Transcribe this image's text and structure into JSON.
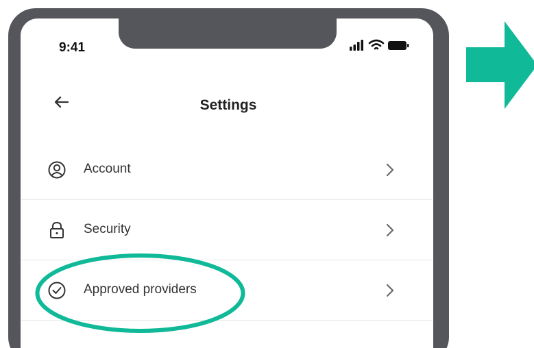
{
  "status_bar": {
    "time": "9:41",
    "signal_icon": "cellular-signal-icon",
    "wifi_icon": "wifi-icon",
    "battery_icon": "battery-icon"
  },
  "header": {
    "back_icon": "back-arrow-icon",
    "title": "Settings"
  },
  "settings": {
    "items": [
      {
        "label": "Account",
        "icon": "account-icon",
        "chevron_icon": "chevron-right-icon"
      },
      {
        "label": "Security",
        "icon": "lock-icon",
        "chevron_icon": "chevron-right-icon"
      },
      {
        "label": "Approved providers",
        "icon": "check-circle-icon",
        "chevron_icon": "chevron-right-icon"
      }
    ]
  },
  "annotations": {
    "highlight_icon": "highlight-ellipse",
    "arrow_icon": "right-arrow-icon"
  },
  "colors": {
    "phone_frame": "#55565b",
    "accent_teal": "#10b998",
    "background": "#ffffff",
    "divider": "#e8e8e8"
  }
}
